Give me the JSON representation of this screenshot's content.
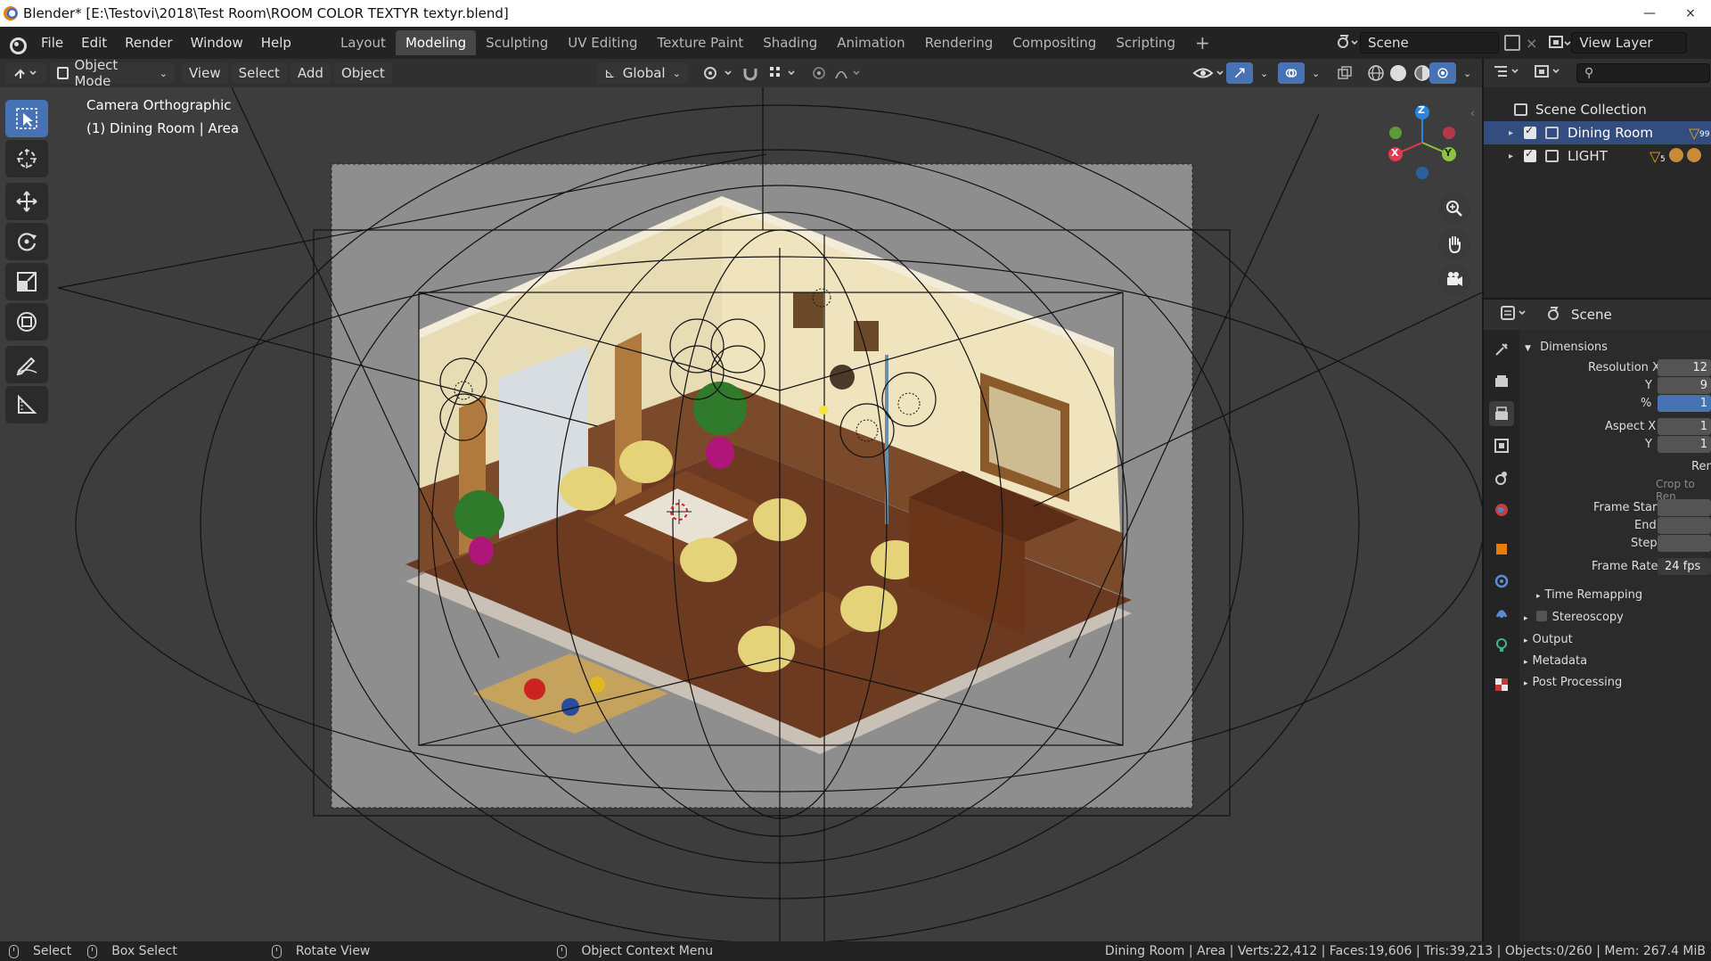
{
  "window": {
    "title": "Blender* [E:\\Testovi\\2018\\Test Room\\ROOM COLOR TEXTYR textyr.blend]",
    "minimize": "—",
    "close": "×"
  },
  "menu": [
    "File",
    "Edit",
    "Render",
    "Window",
    "Help"
  ],
  "workspaces": [
    {
      "label": "Layout",
      "active": false
    },
    {
      "label": "Modeling",
      "active": true
    },
    {
      "label": "Sculpting",
      "active": false
    },
    {
      "label": "UV Editing",
      "active": false
    },
    {
      "label": "Texture Paint",
      "active": false
    },
    {
      "label": "Shading",
      "active": false
    },
    {
      "label": "Animation",
      "active": false
    },
    {
      "label": "Rendering",
      "active": false
    },
    {
      "label": "Compositing",
      "active": false
    },
    {
      "label": "Scripting",
      "active": false
    }
  ],
  "add_workspace": "+",
  "scene_field": "Scene",
  "view_layer_field": "View Layer",
  "viewport_header": {
    "mode": "Object Mode",
    "view": "View",
    "select": "Select",
    "add": "Add",
    "object": "Object",
    "orientation": "Global"
  },
  "viewport_info": {
    "line1": "Camera Orthographic",
    "line2": "(1) Dining Room | Area"
  },
  "gizmo": {
    "x": "X",
    "y": "Y",
    "z": "Z"
  },
  "outliner": {
    "root": "Scene Collection",
    "collections": [
      {
        "name": "Dining Room",
        "selected": true,
        "badge": "99"
      },
      {
        "name": "LIGHT",
        "selected": false,
        "badge": "5"
      }
    ]
  },
  "properties": {
    "header": "Scene",
    "panel": "Dimensions",
    "resolution_x_label": "Resolution X",
    "resolution_x": "12",
    "resolution_y_label": "Y",
    "resolution_y": "9",
    "percent_label": "%",
    "percent": "1",
    "aspect_x_label": "Aspect X",
    "aspect_x": "1",
    "aspect_y_label": "Y",
    "aspect_y": "1",
    "render_region": "Ren",
    "crop": "Crop to Ren",
    "frame_start_label": "Frame Start",
    "frame_end_label": "End",
    "frame_step_label": "Step",
    "frame_rate_label": "Frame Rate",
    "frame_rate": "24 fps",
    "time_remapping": "Time Remapping",
    "stereoscopy": "Stereoscopy",
    "output": "Output",
    "metadata": "Metadata",
    "post_processing": "Post Processing"
  },
  "status": {
    "select": "Select",
    "box_select": "Box Select",
    "rotate_view": "Rotate View",
    "context_menu": "Object Context Menu",
    "stats": "Dining Room | Area | Verts:22,412 | Faces:19,606 | Tris:39,213 | Objects:0/260 | Mem: 267.4 MiB"
  },
  "colors": {
    "accent": "#4772b3",
    "selection": "#334d80",
    "axis_x": "#e23a4e",
    "axis_y": "#8bc53f",
    "axis_z": "#2f83e3"
  }
}
